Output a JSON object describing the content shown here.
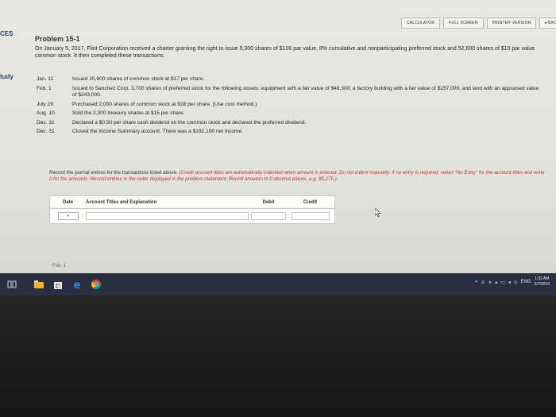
{
  "sidebar": {
    "tab_top": "CES",
    "tab_study": "tudy"
  },
  "toolbar": {
    "calculator": "CALCULATOR",
    "full_screen": "FULL SCREEN",
    "printer_version": "PRINTER VERSION",
    "back": "◂ BACK"
  },
  "problem": {
    "title": "Problem 15-1",
    "intro": "On January 5, 2017, Flint Corporation received a charter granting the right to issue 5,300 shares of $100 par value, 8% cumulative and nonparticipating preferred stock and 52,600 shares of $10 par value common stock. It then completed these transactions."
  },
  "transactions": [
    {
      "date": "Jan. 11",
      "text": "Issued 20,800 shares of common stock at $17 per share."
    },
    {
      "date": "Feb. 1",
      "text": "Issued to Sanchez Corp. 3,700 shares of preferred stock for the following assets: equipment with a fair value of $48,300; a factory building with a fair value of $157,000; and land with an appraised value of $243,000."
    },
    {
      "date": "July 29",
      "text": "Purchased 2,000 shares of common stock at $18 per share. (Use cost method.)"
    },
    {
      "date": "Aug. 10",
      "text": "Sold the 2,000 treasury shares at $15 per share."
    },
    {
      "date": "Dec. 31",
      "text": "Declared a $0.50 per share cash dividend on the common stock and declared the preferred dividend."
    },
    {
      "date": "Dec. 31",
      "text": "Closed the Income Summary account. There was a $192,100 net income."
    }
  ],
  "instructions": {
    "normal": "Record the journal entries for the transactions listed above.",
    "red": "(Credit account titles are automatically indented when amount is entered. Do not indent manually. If no entry is required, select \"No Entry\" for the account titles and enter 0 for the amounts. Record entries in the order displayed in the problem statement. Round answers to 0 decimal places, e.g. $5,275.)"
  },
  "journal": {
    "col_date": "Date",
    "col_account": "Account Titles and Explanation",
    "col_debit": "Debit",
    "col_credit": "Credit",
    "date_dropdown_symbol": "▾"
  },
  "next_section_label": "Feb. 1",
  "taskbar": {
    "tray_lang": "ENG",
    "time": "1:32 AM",
    "date": "2/7/2018"
  }
}
